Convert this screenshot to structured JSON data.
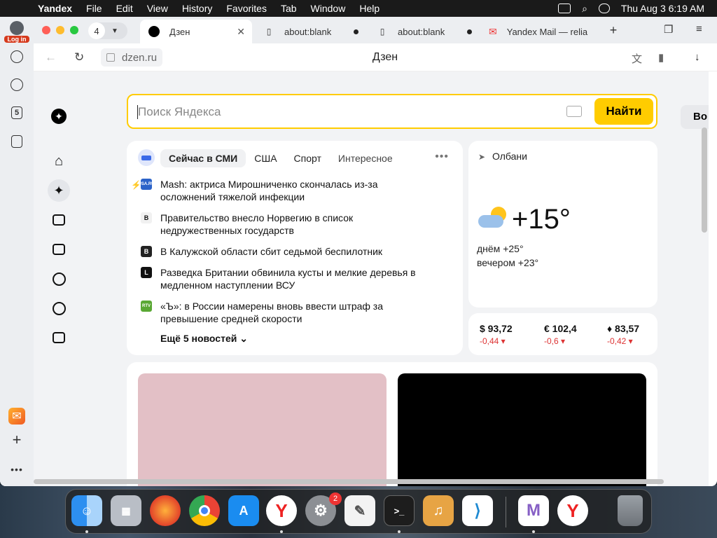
{
  "menubar": {
    "app_name": "Yandex",
    "items": [
      "File",
      "Edit",
      "View",
      "History",
      "Favorites",
      "Tab",
      "Window",
      "Help"
    ],
    "clock": "Thu Aug 3  6:19 AM"
  },
  "sidepanel": {
    "login_label": "Log in",
    "tabs_count_badge": "5"
  },
  "tabbar": {
    "tab_count": "4",
    "tabs": [
      {
        "title": "Дзен",
        "active": true
      },
      {
        "title": "about:blank",
        "active": false
      },
      {
        "title": "about:blank",
        "active": false
      },
      {
        "title": "Yandex Mail — relia",
        "active": false
      }
    ]
  },
  "addressbar": {
    "url": "dzen.ru",
    "page_title": "Дзен"
  },
  "search": {
    "placeholder": "Поиск Яндекса",
    "button_label": "Найти",
    "side_button": "Во"
  },
  "news": {
    "tabs": [
      "Сейчас в СМИ",
      "США",
      "Спорт",
      "Интересное"
    ],
    "active_tab": "Сейчас в СМИ",
    "items": [
      {
        "source_logo": "USA.RU",
        "text": "Mash: актриса Мирошниченко скончалась из-за осложнений тяжелой инфекции",
        "hot": true,
        "color": "#2b63c9"
      },
      {
        "source_logo": "B",
        "text": "Правительство внесло Норвегию в список недружественных государств",
        "hot": false,
        "color": "#f1f1f1"
      },
      {
        "source_logo": "B",
        "text": "В Калужской области сбит седьмой беспилотник",
        "hot": false,
        "color": "#222222"
      },
      {
        "source_logo": "L",
        "text": "Разведка Британии обвинила кусты и мелкие деревья в медленном наступлении ВСУ",
        "hot": false,
        "color": "#111111"
      },
      {
        "source_logo": "RTV",
        "text": "«Ъ»: в России намерены вновь ввести штраф за превышение средней скорости",
        "hot": false,
        "color": "#5aa834"
      }
    ],
    "more_label": "Ещё 5 новостей"
  },
  "weather": {
    "location": "Олбани",
    "temperature": "+15°",
    "day": "днём +25°",
    "evening": "вечером +23°"
  },
  "rates": [
    {
      "value": "$ 93,72",
      "change": "-0,44 ▾"
    },
    {
      "value": "€ 102,4",
      "change": "-0,6 ▾"
    },
    {
      "value": "83,57",
      "change": "-0,42 ▾"
    }
  ],
  "dock": {
    "apps": [
      "finder",
      "launchpad",
      "firefox",
      "chrome",
      "app-store",
      "yandex-browser",
      "system-settings",
      "textedit",
      "terminal",
      "garageband",
      "vscode",
      "visual-studio",
      "yandex",
      "trash"
    ],
    "settings_badge": "2"
  },
  "colors": {
    "accent_yellow": "#ffcc00",
    "negative_red": "#dd3333"
  }
}
